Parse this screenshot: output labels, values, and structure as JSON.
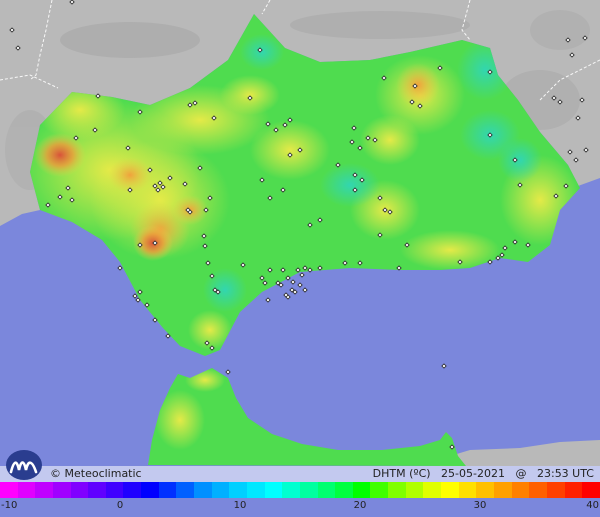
{
  "brand": {
    "copyright": "© Meteoclimatic",
    "logo_icon": "meteoclimatic-logo-icon"
  },
  "map_info": {
    "variable": "DHTM (ºC)",
    "date": "25-05-2021",
    "at": "@",
    "time": "23:53 UTC"
  },
  "colorbar": {
    "min": -10,
    "max": 40,
    "tick_labels": [
      "-10",
      "0",
      "10",
      "20",
      "30",
      "40"
    ],
    "tick_values": [
      -10,
      0,
      10,
      20,
      30,
      40
    ],
    "colors": [
      "#ff00ff",
      "#e000ff",
      "#c000ff",
      "#a000ff",
      "#8000ff",
      "#6000ff",
      "#4000ff",
      "#2000ff",
      "#0000ff",
      "#0030ff",
      "#0060ff",
      "#0090ff",
      "#00b0ff",
      "#00d0ff",
      "#00e8ff",
      "#00ffff",
      "#00ffd0",
      "#00ffa0",
      "#00ff70",
      "#00ff40",
      "#00ff00",
      "#40ff00",
      "#80ff00",
      "#b0ff00",
      "#e0ff00",
      "#ffff00",
      "#ffe000",
      "#ffc000",
      "#ffa000",
      "#ff8000",
      "#ff6000",
      "#ff4000",
      "#ff2000",
      "#ff0000"
    ]
  },
  "colors": {
    "sea": "#7b87dc",
    "land_outside": "#b7b7b7",
    "base_green": "#4fdc4f",
    "yellow": "#dde84a",
    "orange": "#ee9a3a",
    "red": "#d9573a",
    "teal": "#3ad9a6"
  }
}
